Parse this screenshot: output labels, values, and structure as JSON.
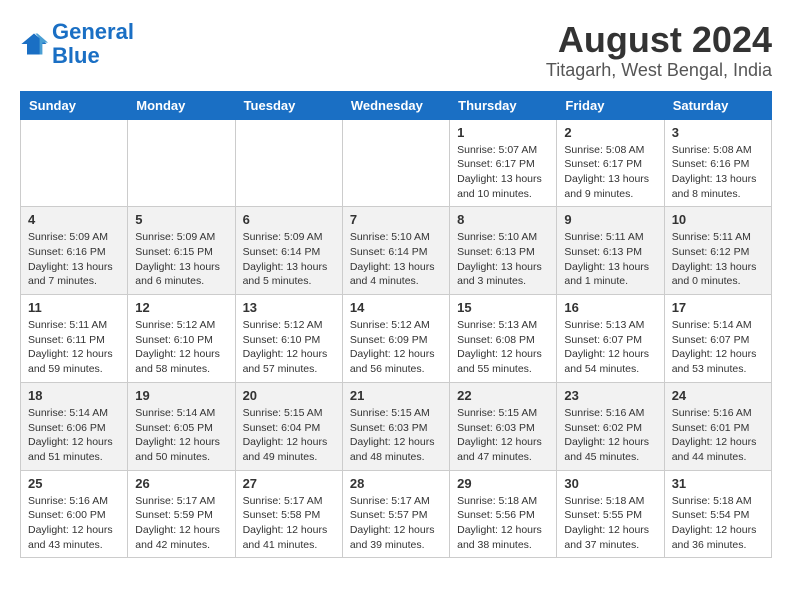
{
  "logo": {
    "line1": "General",
    "line2": "Blue"
  },
  "title": "August 2024",
  "subtitle": "Titagarh, West Bengal, India",
  "weekdays": [
    "Sunday",
    "Monday",
    "Tuesday",
    "Wednesday",
    "Thursday",
    "Friday",
    "Saturday"
  ],
  "weeks": [
    [
      {
        "day": "",
        "info": ""
      },
      {
        "day": "",
        "info": ""
      },
      {
        "day": "",
        "info": ""
      },
      {
        "day": "",
        "info": ""
      },
      {
        "day": "1",
        "info": "Sunrise: 5:07 AM\nSunset: 6:17 PM\nDaylight: 13 hours\nand 10 minutes."
      },
      {
        "day": "2",
        "info": "Sunrise: 5:08 AM\nSunset: 6:17 PM\nDaylight: 13 hours\nand 9 minutes."
      },
      {
        "day": "3",
        "info": "Sunrise: 5:08 AM\nSunset: 6:16 PM\nDaylight: 13 hours\nand 8 minutes."
      }
    ],
    [
      {
        "day": "4",
        "info": "Sunrise: 5:09 AM\nSunset: 6:16 PM\nDaylight: 13 hours\nand 7 minutes."
      },
      {
        "day": "5",
        "info": "Sunrise: 5:09 AM\nSunset: 6:15 PM\nDaylight: 13 hours\nand 6 minutes."
      },
      {
        "day": "6",
        "info": "Sunrise: 5:09 AM\nSunset: 6:14 PM\nDaylight: 13 hours\nand 5 minutes."
      },
      {
        "day": "7",
        "info": "Sunrise: 5:10 AM\nSunset: 6:14 PM\nDaylight: 13 hours\nand 4 minutes."
      },
      {
        "day": "8",
        "info": "Sunrise: 5:10 AM\nSunset: 6:13 PM\nDaylight: 13 hours\nand 3 minutes."
      },
      {
        "day": "9",
        "info": "Sunrise: 5:11 AM\nSunset: 6:13 PM\nDaylight: 13 hours\nand 1 minute."
      },
      {
        "day": "10",
        "info": "Sunrise: 5:11 AM\nSunset: 6:12 PM\nDaylight: 13 hours\nand 0 minutes."
      }
    ],
    [
      {
        "day": "11",
        "info": "Sunrise: 5:11 AM\nSunset: 6:11 PM\nDaylight: 12 hours\nand 59 minutes."
      },
      {
        "day": "12",
        "info": "Sunrise: 5:12 AM\nSunset: 6:10 PM\nDaylight: 12 hours\nand 58 minutes."
      },
      {
        "day": "13",
        "info": "Sunrise: 5:12 AM\nSunset: 6:10 PM\nDaylight: 12 hours\nand 57 minutes."
      },
      {
        "day": "14",
        "info": "Sunrise: 5:12 AM\nSunset: 6:09 PM\nDaylight: 12 hours\nand 56 minutes."
      },
      {
        "day": "15",
        "info": "Sunrise: 5:13 AM\nSunset: 6:08 PM\nDaylight: 12 hours\nand 55 minutes."
      },
      {
        "day": "16",
        "info": "Sunrise: 5:13 AM\nSunset: 6:07 PM\nDaylight: 12 hours\nand 54 minutes."
      },
      {
        "day": "17",
        "info": "Sunrise: 5:14 AM\nSunset: 6:07 PM\nDaylight: 12 hours\nand 53 minutes."
      }
    ],
    [
      {
        "day": "18",
        "info": "Sunrise: 5:14 AM\nSunset: 6:06 PM\nDaylight: 12 hours\nand 51 minutes."
      },
      {
        "day": "19",
        "info": "Sunrise: 5:14 AM\nSunset: 6:05 PM\nDaylight: 12 hours\nand 50 minutes."
      },
      {
        "day": "20",
        "info": "Sunrise: 5:15 AM\nSunset: 6:04 PM\nDaylight: 12 hours\nand 49 minutes."
      },
      {
        "day": "21",
        "info": "Sunrise: 5:15 AM\nSunset: 6:03 PM\nDaylight: 12 hours\nand 48 minutes."
      },
      {
        "day": "22",
        "info": "Sunrise: 5:15 AM\nSunset: 6:03 PM\nDaylight: 12 hours\nand 47 minutes."
      },
      {
        "day": "23",
        "info": "Sunrise: 5:16 AM\nSunset: 6:02 PM\nDaylight: 12 hours\nand 45 minutes."
      },
      {
        "day": "24",
        "info": "Sunrise: 5:16 AM\nSunset: 6:01 PM\nDaylight: 12 hours\nand 44 minutes."
      }
    ],
    [
      {
        "day": "25",
        "info": "Sunrise: 5:16 AM\nSunset: 6:00 PM\nDaylight: 12 hours\nand 43 minutes."
      },
      {
        "day": "26",
        "info": "Sunrise: 5:17 AM\nSunset: 5:59 PM\nDaylight: 12 hours\nand 42 minutes."
      },
      {
        "day": "27",
        "info": "Sunrise: 5:17 AM\nSunset: 5:58 PM\nDaylight: 12 hours\nand 41 minutes."
      },
      {
        "day": "28",
        "info": "Sunrise: 5:17 AM\nSunset: 5:57 PM\nDaylight: 12 hours\nand 39 minutes."
      },
      {
        "day": "29",
        "info": "Sunrise: 5:18 AM\nSunset: 5:56 PM\nDaylight: 12 hours\nand 38 minutes."
      },
      {
        "day": "30",
        "info": "Sunrise: 5:18 AM\nSunset: 5:55 PM\nDaylight: 12 hours\nand 37 minutes."
      },
      {
        "day": "31",
        "info": "Sunrise: 5:18 AM\nSunset: 5:54 PM\nDaylight: 12 hours\nand 36 minutes."
      }
    ]
  ]
}
